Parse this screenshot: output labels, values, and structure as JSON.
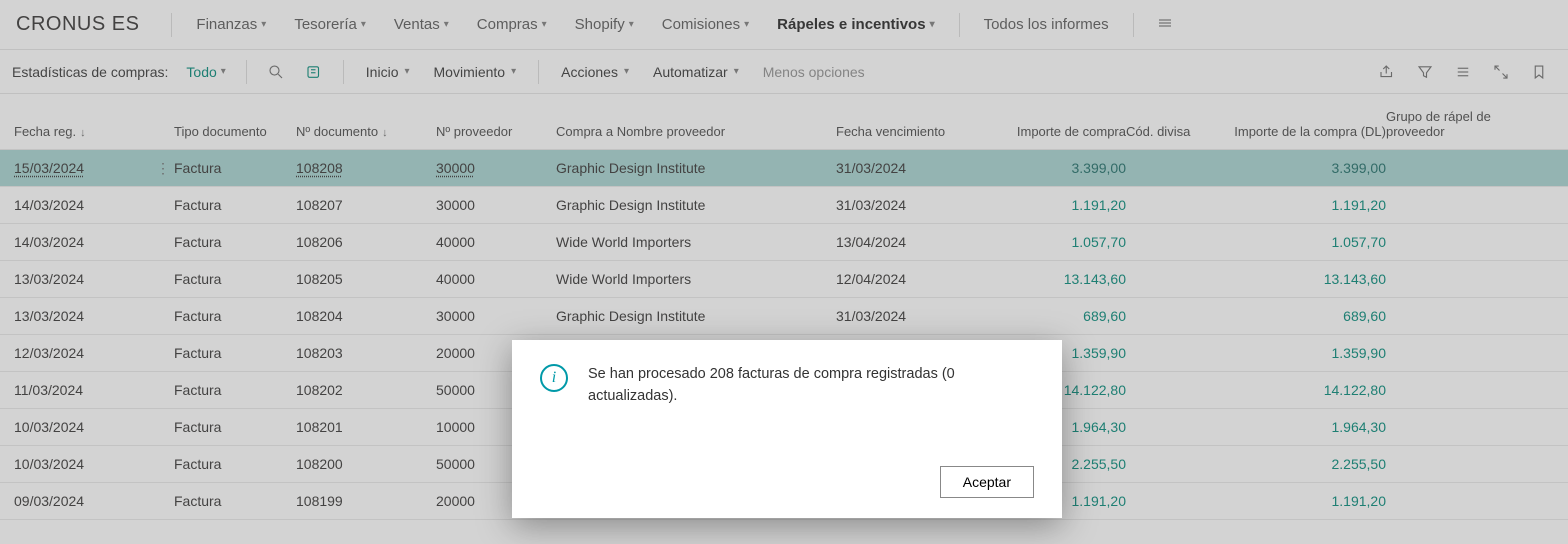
{
  "brand": "CRONUS ES",
  "nav": {
    "items": [
      {
        "label": "Finanzas"
      },
      {
        "label": "Tesorería"
      },
      {
        "label": "Ventas"
      },
      {
        "label": "Compras"
      },
      {
        "label": "Shopify"
      },
      {
        "label": "Comisiones"
      },
      {
        "label": "Rápeles e incentivos",
        "active": true
      }
    ],
    "allReports": "Todos los informes"
  },
  "actionbar": {
    "title": "Estadísticas de compras:",
    "filter": "Todo",
    "inicio": "Inicio",
    "movimiento": "Movimiento",
    "acciones": "Acciones",
    "automatizar": "Automatizar",
    "menos": "Menos opciones"
  },
  "columns": {
    "fechaReg": "Fecha reg.",
    "tipoDoc": "Tipo documento",
    "nDoc": "Nº documento",
    "nProv": "Nº proveedor",
    "compraNombre": "Compra a Nombre proveedor",
    "fechaVenc": "Fecha vencimiento",
    "importe": "Importe de compra",
    "codDivisa": "Cód. divisa",
    "importeDL": "Importe de la compra (DL)",
    "grupoRapel": "Grupo de rápel de proveedor"
  },
  "rows": [
    {
      "fechaReg": "15/03/2024",
      "tipoDoc": "Factura",
      "nDoc": "108208",
      "nProv": "30000",
      "nombre": "Graphic Design Institute",
      "fechaVenc": "31/03/2024",
      "importe": "3.399,00",
      "codDivisa": "",
      "importeDL": "3.399,00",
      "grupo": "",
      "selected": true
    },
    {
      "fechaReg": "14/03/2024",
      "tipoDoc": "Factura",
      "nDoc": "108207",
      "nProv": "30000",
      "nombre": "Graphic Design Institute",
      "fechaVenc": "31/03/2024",
      "importe": "1.191,20",
      "codDivisa": "",
      "importeDL": "1.191,20",
      "grupo": ""
    },
    {
      "fechaReg": "14/03/2024",
      "tipoDoc": "Factura",
      "nDoc": "108206",
      "nProv": "40000",
      "nombre": "Wide World Importers",
      "fechaVenc": "13/04/2024",
      "importe": "1.057,70",
      "codDivisa": "",
      "importeDL": "1.057,70",
      "grupo": ""
    },
    {
      "fechaReg": "13/03/2024",
      "tipoDoc": "Factura",
      "nDoc": "108205",
      "nProv": "40000",
      "nombre": "Wide World Importers",
      "fechaVenc": "12/04/2024",
      "importe": "13.143,60",
      "codDivisa": "",
      "importeDL": "13.143,60",
      "grupo": ""
    },
    {
      "fechaReg": "13/03/2024",
      "tipoDoc": "Factura",
      "nDoc": "108204",
      "nProv": "30000",
      "nombre": "Graphic Design Institute",
      "fechaVenc": "31/03/2024",
      "importe": "689,60",
      "codDivisa": "",
      "importeDL": "689,60",
      "grupo": ""
    },
    {
      "fechaReg": "12/03/2024",
      "tipoDoc": "Factura",
      "nDoc": "108203",
      "nProv": "20000",
      "nombre": "",
      "fechaVenc": "",
      "importe": "1.359,90",
      "codDivisa": "",
      "importeDL": "1.359,90",
      "grupo": ""
    },
    {
      "fechaReg": "11/03/2024",
      "tipoDoc": "Factura",
      "nDoc": "108202",
      "nProv": "50000",
      "nombre": "",
      "fechaVenc": "",
      "importe": "14.122,80",
      "codDivisa": "",
      "importeDL": "14.122,80",
      "grupo": ""
    },
    {
      "fechaReg": "10/03/2024",
      "tipoDoc": "Factura",
      "nDoc": "108201",
      "nProv": "10000",
      "nombre": "",
      "fechaVenc": "",
      "importe": "1.964,30",
      "codDivisa": "",
      "importeDL": "1.964,30",
      "grupo": ""
    },
    {
      "fechaReg": "10/03/2024",
      "tipoDoc": "Factura",
      "nDoc": "108200",
      "nProv": "50000",
      "nombre": "",
      "fechaVenc": "",
      "importe": "2.255,50",
      "codDivisa": "",
      "importeDL": "2.255,50",
      "grupo": ""
    },
    {
      "fechaReg": "09/03/2024",
      "tipoDoc": "Factura",
      "nDoc": "108199",
      "nProv": "20000",
      "nombre": "",
      "fechaVenc": "",
      "importe": "1.191,20",
      "codDivisa": "",
      "importeDL": "1.191,20",
      "grupo": ""
    }
  ],
  "dialog": {
    "message": "Se han procesado 208 facturas de compra registradas (0 actualizadas).",
    "ok": "Aceptar"
  }
}
